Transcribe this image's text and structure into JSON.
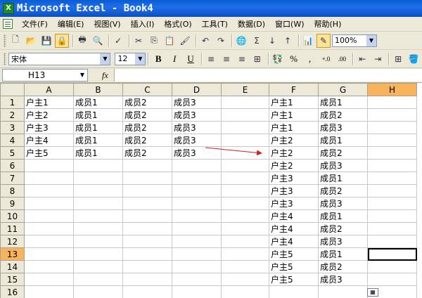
{
  "window": {
    "title": "Microsoft Excel - Book4",
    "icon": "excel-app-icon"
  },
  "menu": [
    "文件(F)",
    "编辑(E)",
    "视图(V)",
    "插入(I)",
    "格式(O)",
    "工具(T)",
    "数据(D)",
    "窗口(W)",
    "帮助(H)"
  ],
  "toolbar": {
    "zoom": "100%",
    "font": "宋体",
    "font_size": "12",
    "bold": "B",
    "italic": "I",
    "underline": "U",
    "percent": "%",
    "comma": ",",
    "inc_decimal": "+.0",
    "dec_decimal": ".00",
    "sum": "Σ"
  },
  "formula_bar": {
    "name_box": "H13",
    "fx": "fx",
    "formula": ""
  },
  "columns": [
    "A",
    "B",
    "C",
    "D",
    "E",
    "F",
    "G",
    "H"
  ],
  "selected_cell": {
    "column": "H",
    "row": "13"
  },
  "rows": [
    {
      "n": "1",
      "A": "户主1",
      "B": "成员1",
      "C": "成员2",
      "D": "成员3",
      "F": "户主1",
      "G": "成员1"
    },
    {
      "n": "2",
      "A": "户主2",
      "B": "成员1",
      "C": "成员2",
      "D": "成员3",
      "F": "户主1",
      "G": "成员2"
    },
    {
      "n": "3",
      "A": "户主3",
      "B": "成员1",
      "C": "成员2",
      "D": "成员3",
      "F": "户主1",
      "G": "成员3"
    },
    {
      "n": "4",
      "A": "户主4",
      "B": "成员1",
      "C": "成员2",
      "D": "成员3",
      "F": "户主2",
      "G": "成员1"
    },
    {
      "n": "5",
      "A": "户主5",
      "B": "成员1",
      "C": "成员2",
      "D": "成员3",
      "F": "户主2",
      "G": "成员2"
    },
    {
      "n": "6",
      "A": "",
      "B": "",
      "C": "",
      "D": "",
      "F": "户主2",
      "G": "成员3"
    },
    {
      "n": "7",
      "A": "",
      "B": "",
      "C": "",
      "D": "",
      "F": "户主3",
      "G": "成员1"
    },
    {
      "n": "8",
      "A": "",
      "B": "",
      "C": "",
      "D": "",
      "F": "户主3",
      "G": "成员2"
    },
    {
      "n": "9",
      "A": "",
      "B": "",
      "C": "",
      "D": "",
      "F": "户主3",
      "G": "成员3"
    },
    {
      "n": "10",
      "A": "",
      "B": "",
      "C": "",
      "D": "",
      "F": "户主4",
      "G": "成员1"
    },
    {
      "n": "11",
      "A": "",
      "B": "",
      "C": "",
      "D": "",
      "F": "户主4",
      "G": "成员2"
    },
    {
      "n": "12",
      "A": "",
      "B": "",
      "C": "",
      "D": "",
      "F": "户主4",
      "G": "成员3"
    },
    {
      "n": "13",
      "A": "",
      "B": "",
      "C": "",
      "D": "",
      "F": "户主5",
      "G": "成员1"
    },
    {
      "n": "14",
      "A": "",
      "B": "",
      "C": "",
      "D": "",
      "F": "户主5",
      "G": "成员2"
    },
    {
      "n": "15",
      "A": "",
      "B": "",
      "C": "",
      "D": "",
      "F": "户主5",
      "G": "成员3"
    },
    {
      "n": "16",
      "A": "",
      "B": "",
      "C": "",
      "D": "",
      "F": "",
      "G": ""
    }
  ],
  "annotation": {
    "arrow_color": "#cc2222"
  },
  "colors": {
    "titlebar": "#0a5bd6",
    "header_selected": "#f9b35a"
  }
}
